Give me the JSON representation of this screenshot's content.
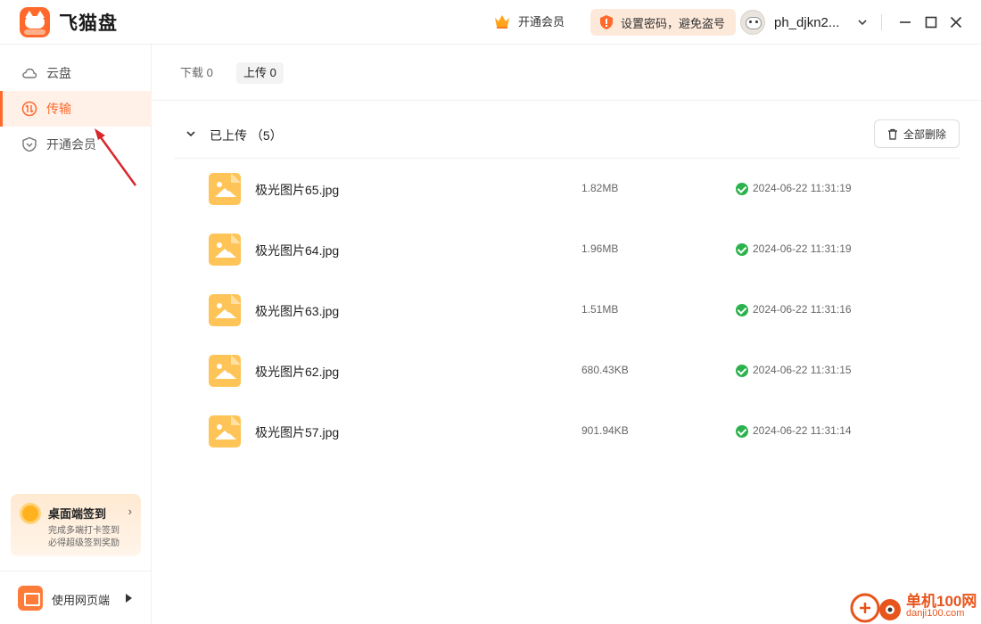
{
  "app": {
    "name": "飞猫盘",
    "logo_badge": "100G"
  },
  "header": {
    "vip_label": "开通会员",
    "password_tip": "设置密码，避免盗号",
    "username": "ph_djkn2...",
    "icons": {
      "vip": "crown-icon",
      "password": "shield-icon",
      "user_menu": "chevron-down-icon",
      "minimize": "minimize-icon",
      "maximize": "maximize-icon",
      "close": "close-icon"
    }
  },
  "sidebar": {
    "items": [
      {
        "label": "云盘",
        "icon": "cloud-icon",
        "active": false
      },
      {
        "label": "传输",
        "icon": "transfer-icon",
        "active": true
      },
      {
        "label": "开通会员",
        "icon": "vip-shield-icon",
        "active": false
      }
    ],
    "signin_card": {
      "title": "桌面端签到",
      "line1": "完成多端打卡签到",
      "line2": "必得超级签到奖励",
      "arrow": "›"
    },
    "web_entry": {
      "label": "使用网页端"
    }
  },
  "main": {
    "tabs": [
      {
        "label": "下载 0",
        "active": false
      },
      {
        "label": "上传 0",
        "active": true
      }
    ],
    "section": {
      "title": "已上传 （5）",
      "delete_all_label": "全部删除"
    },
    "files": [
      {
        "name": "极光图片65.jpg",
        "size": "1.82MB",
        "time": "2024-06-22 11:31:19"
      },
      {
        "name": "极光图片64.jpg",
        "size": "1.96MB",
        "time": "2024-06-22 11:31:19"
      },
      {
        "name": "极光图片63.jpg",
        "size": "1.51MB",
        "time": "2024-06-22 11:31:16"
      },
      {
        "name": "极光图片62.jpg",
        "size": "680.43KB",
        "time": "2024-06-22 11:31:15"
      },
      {
        "name": "极光图片57.jpg",
        "size": "901.94KB",
        "time": "2024-06-22 11:31:14"
      }
    ]
  },
  "watermark": {
    "site_name": "单机100网",
    "url": "danji100.com"
  },
  "colors": {
    "accent": "#ff6a2c",
    "success": "#2bb24c",
    "annotation": "#d9262c",
    "watermark": "#e8551c"
  }
}
